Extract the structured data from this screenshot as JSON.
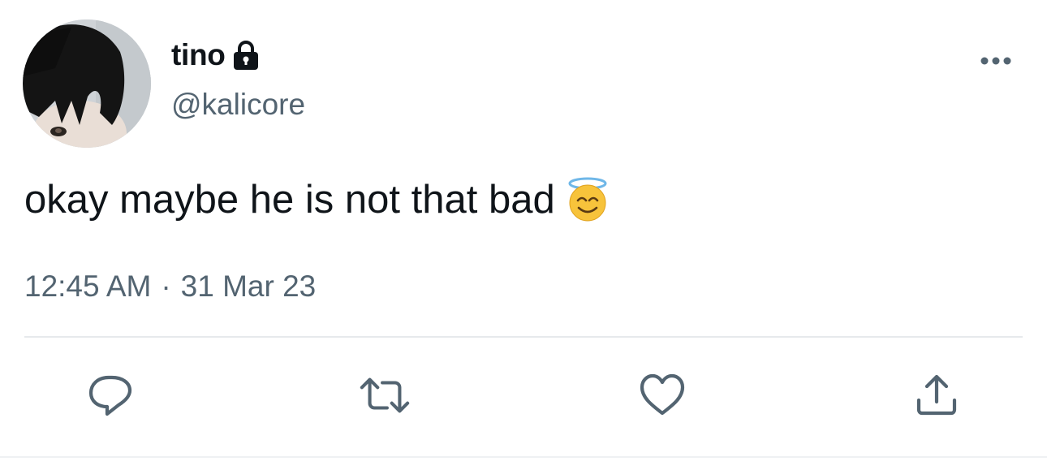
{
  "tweet": {
    "display_name": "tino",
    "handle": "@kalicore",
    "protected_icon": "lock-icon",
    "text": "okay maybe he is not that bad",
    "emoji": "smiling-face-with-halo",
    "time": "12:45 AM",
    "separator": "·",
    "date": "31 Mar 23"
  },
  "actions": {
    "reply_icon": "reply-icon",
    "retweet_icon": "retweet-icon",
    "like_icon": "heart-icon",
    "share_icon": "share-icon",
    "more_icon": "more-icon"
  },
  "colors": {
    "text_primary": "#0f1419",
    "text_secondary": "#536471",
    "icon": "#536471",
    "divider": "#e6e9ec"
  }
}
